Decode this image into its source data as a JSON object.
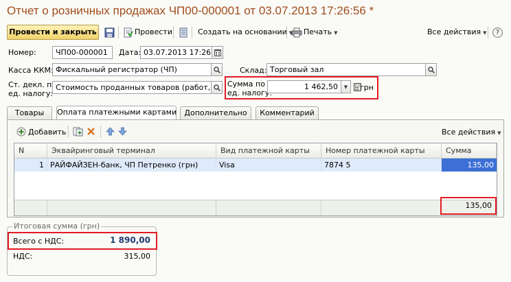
{
  "window": {
    "title": "Отчет о розничных продажах ЧП00-000001 от 03.07.2013 17:26:56 *"
  },
  "toolbar": {
    "post_close": "Провести и закрыть",
    "post": "Провести",
    "create_based": "Создать на основании",
    "print": "Печать",
    "all_actions": "Все действия",
    "help": "?"
  },
  "form": {
    "number_label": "Номер:",
    "number_value": "ЧП00-000001",
    "date_label": "Дата:",
    "date_value": "03.07.2013 17:26:56",
    "kkm_label": "Касса ККМ:",
    "kkm_value": "Фискальный регистратор (ЧП)",
    "warehouse_label": "Склад:",
    "warehouse_value": "Торговый зал",
    "tax_line1": "Ст. декл. по",
    "tax_line2": "ед. налогу:",
    "tax_value": "Стоимость проданных товаров (работ, усл",
    "sum_line1": "Сумма по",
    "sum_line2": "ед. налогу:",
    "sum_value": "1 462,50",
    "currency": "грн"
  },
  "tabs": [
    {
      "label": "Товары"
    },
    {
      "label": "Оплата платежными картами"
    },
    {
      "label": "Дополнительно"
    },
    {
      "label": "Комментарий"
    }
  ],
  "payments": {
    "add_label": "Добавить",
    "all_actions": "Все действия",
    "columns": [
      "N",
      "Эквайринговый терминал",
      "Вид платежной карты",
      "Номер платежной карты",
      "Сумма"
    ],
    "rows": [
      {
        "n": "1",
        "terminal": "РАЙФАЙЗЕН-банк, ЧП Петренко (грн)",
        "card_type": "Visa",
        "card_number": "7874 5",
        "sum": "135,00"
      }
    ],
    "total": "135,00"
  },
  "totals": {
    "group_title": "Итоговая сумма (грн)",
    "total_vat_label": "Всего с НДС:",
    "total_vat_value": "1 890,00",
    "vat_label": "НДС:",
    "vat_value": "315,00"
  },
  "colors": {
    "title": "#a04c1c",
    "highlight": "#e21b23",
    "selected_row": "#dfeafa",
    "selected_cell": "#3d6fd6"
  }
}
